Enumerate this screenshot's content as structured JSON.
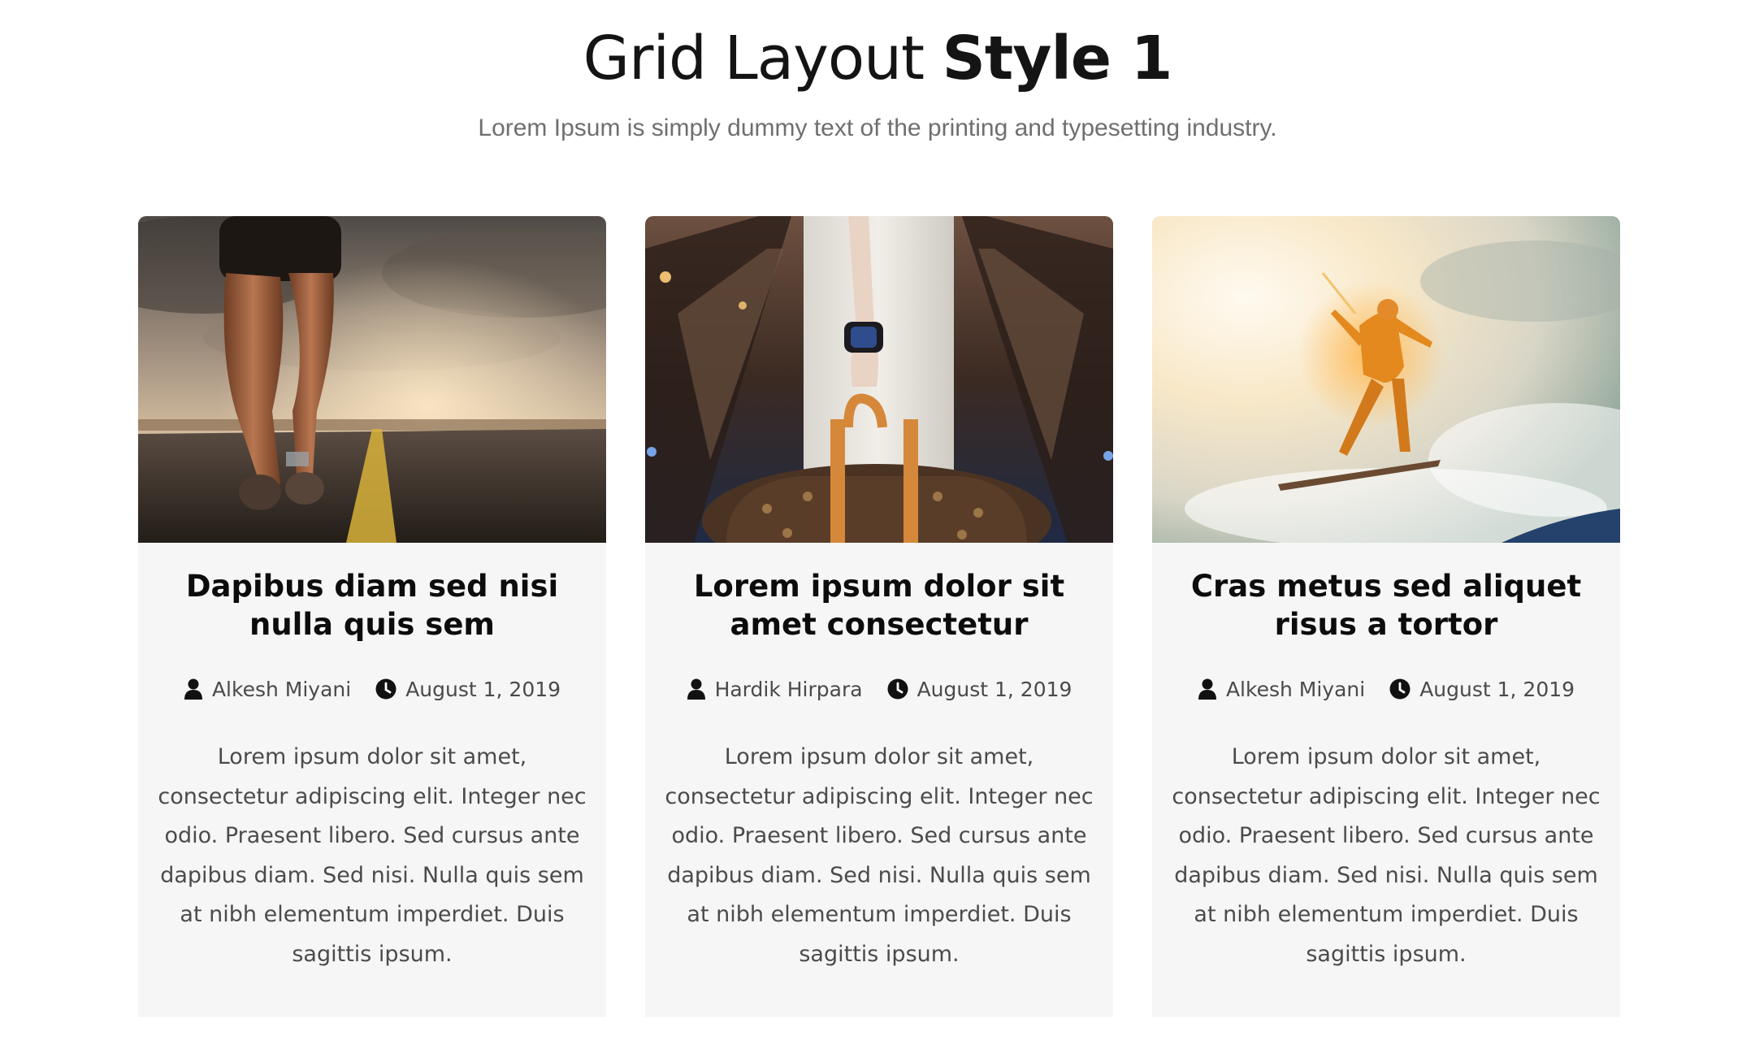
{
  "header": {
    "title_regular": "Grid Layout",
    "title_bold": "Style 1",
    "subtitle": "Lorem Ipsum is simply dummy text of the printing and typesetting industry."
  },
  "cards": [
    {
      "image": "runner-on-road-photo",
      "title": "Dapibus diam sed nisi nulla quis sem",
      "author": "Alkesh Miyani",
      "date": "August 1, 2019",
      "excerpt": "Lorem ipsum dolor sit amet, consectetur adipiscing elit. Integer nec odio. Praesent libero. Sed cursus ante dapibus diam. Sed nisi. Nulla quis sem at nibh elementum imperdiet. Duis sagittis ipsum."
    },
    {
      "image": "woman-with-handbag-photo",
      "title": "Lorem ipsum dolor sit amet consectetur",
      "author": "Hardik Hirpara",
      "date": "August 1, 2019",
      "excerpt": "Lorem ipsum dolor sit amet, consectetur adipiscing elit. Integer nec odio. Praesent libero. Sed cursus ante dapibus diam. Sed nisi. Nulla quis sem at nibh elementum imperdiet. Duis sagittis ipsum."
    },
    {
      "image": "kitesurfer-jumping-photo",
      "title": "Cras metus sed aliquet risus a tortor",
      "author": "Alkesh Miyani",
      "date": "August 1, 2019",
      "excerpt": "Lorem ipsum dolor sit amet, consectetur adipiscing elit. Integer nec odio. Praesent libero. Sed cursus ante dapibus diam. Sed nisi. Nulla quis sem at nibh elementum imperdiet. Duis sagittis ipsum."
    }
  ],
  "icons": {
    "author": "user-icon",
    "date": "clock-icon"
  },
  "colors": {
    "card_background": "#f6f6f6",
    "title_text": "#0c0c0c",
    "subtitle_text": "#6f6f6f",
    "body_text": "#4b4b4b"
  }
}
